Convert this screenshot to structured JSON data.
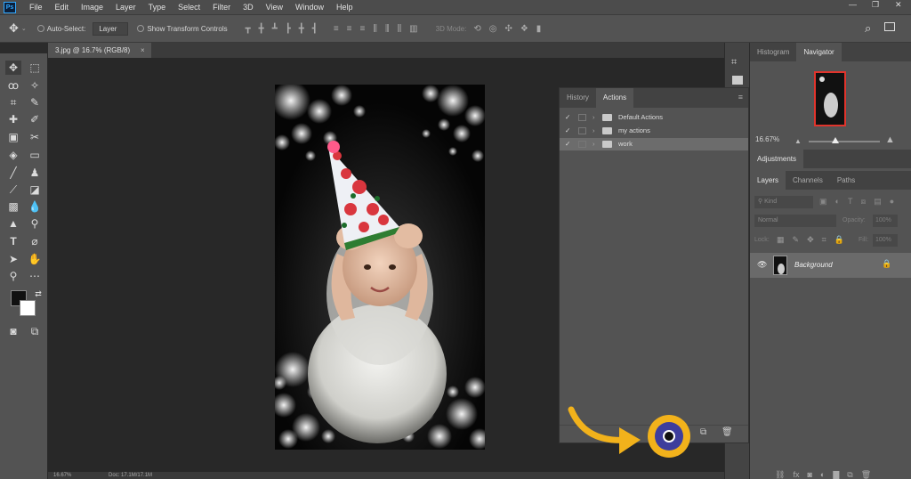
{
  "menubar": {
    "logo": "Ps",
    "items": [
      "File",
      "Edit",
      "Image",
      "Layer",
      "Type",
      "Select",
      "Filter",
      "3D",
      "View",
      "Window",
      "Help"
    ]
  },
  "window_controls": {
    "minimize": "—",
    "restore": "❐",
    "close": "✕"
  },
  "options": {
    "auto_select_label": "Auto-Select:",
    "auto_select_value": "Layer",
    "transform_label": "Show Transform Controls",
    "mode_3d_label": "3D Mode:"
  },
  "document": {
    "tab_title": "3.jpg @ 16.7% (RGB/8)",
    "close": "×"
  },
  "actions_panel": {
    "tabs": [
      "History",
      "Actions"
    ],
    "active_tab": "Actions",
    "rows": [
      {
        "label": "Default Actions"
      },
      {
        "label": "my actions"
      },
      {
        "label": "work"
      }
    ]
  },
  "navigator": {
    "tabs": [
      "Histogram",
      "Navigator"
    ],
    "active_tab": "Navigator",
    "zoom": "16.67%"
  },
  "adjustments": {
    "title": "Adjustments"
  },
  "layers": {
    "tabs": [
      "Layers",
      "Channels",
      "Paths"
    ],
    "active_tab": "Layers",
    "kind_label": "Kind",
    "blend_mode": "Normal",
    "opacity_label": "Opacity:",
    "opacity_value": "100%",
    "lock_label": "Lock:",
    "fill_label": "Fill:",
    "fill_value": "100%",
    "layer_name": "Background"
  },
  "status": {
    "zoom": "16.67%",
    "doc": "Doc: 17.1M/17.1M"
  },
  "colors": {
    "accent_orange": "#f2b21b",
    "ui_panel": "#535353",
    "ui_dark": "#2b2b2b"
  }
}
